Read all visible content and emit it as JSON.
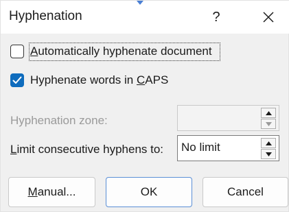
{
  "dialog": {
    "title": "Hyphenation",
    "help_label": "?"
  },
  "options": {
    "auto_hyphenate": {
      "label_accel": "A",
      "label_rest": "utomatically hyphenate document",
      "checked": false
    },
    "hyphenate_caps": {
      "label_pre": "Hyphenate words in ",
      "label_accel": "C",
      "label_rest": "APS",
      "checked": true
    }
  },
  "fields": {
    "hyphenation_zone": {
      "label": "Hyphenation zone:",
      "value": "",
      "enabled": false
    },
    "limit_consecutive": {
      "label_accel": "L",
      "label_rest": "imit consecutive hyphens to:",
      "value": "No limit",
      "enabled": true
    }
  },
  "buttons": {
    "manual": {
      "label_accel": "M",
      "label_rest": "anual..."
    },
    "ok": {
      "label": "OK"
    },
    "cancel": {
      "label": "Cancel"
    }
  },
  "colors": {
    "accent": "#0f6cbd",
    "dialog_bg": "#f0f0f0",
    "disabled_text": "#9a9a9a"
  },
  "icons": {
    "close": "close-icon",
    "checkmark": "checkmark-icon",
    "spin_up": "triangle-up-icon",
    "spin_down": "triangle-down-icon"
  }
}
